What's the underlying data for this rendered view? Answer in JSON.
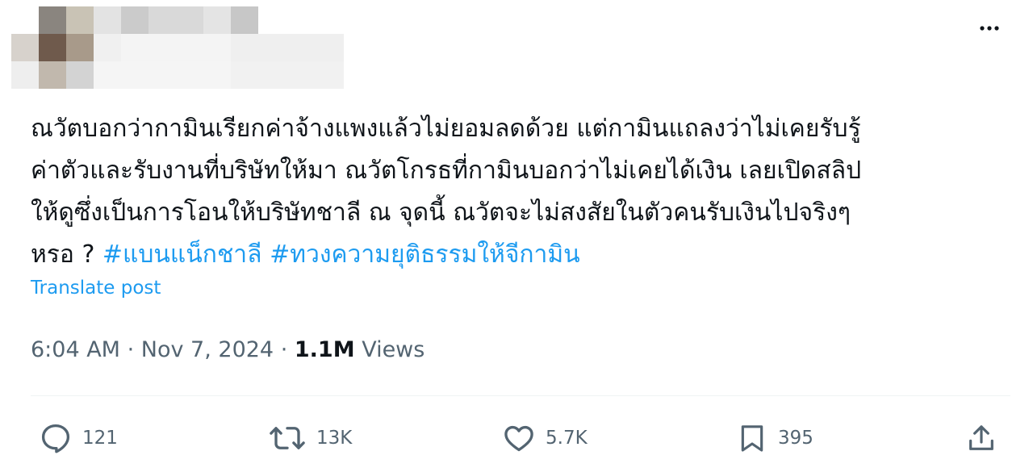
{
  "tweet": {
    "text_lines": [
      "ณวัตบอกว่ากามินเรียกค่าจ้างแพงแล้วไม่ยอมลดด้วย แต่กามินแถลงว่าไม่เคยรับรู้",
      "ค่าตัวและรับงานที่บริษัทให้มา ณวัตโกรธที่กามินบอกว่าไม่เคยได้เงิน เลยเปิดสลิป",
      "ให้ดูซึ่งเป็นการโอนให้บริษัทชาลี ณ จุดนี้ ณวัตจะไม่สงสัยในตัวคนรับเงินไปจริงๆ"
    ],
    "last_line_text": "หรอ ? ",
    "hashtags": [
      "#แบนแน็กชาลี",
      "#ทวงความยุติธรรมให้จีกามิน"
    ],
    "translate_label": "Translate post",
    "time": "6:04 AM",
    "date": "Nov 7, 2024",
    "separator": "·",
    "views_count": "1.1M",
    "views_label": "Views"
  },
  "actions": {
    "replies": "121",
    "reposts": "13K",
    "likes": "5.7K",
    "bookmarks": "395"
  },
  "colors": {
    "accent": "#1d9bf0",
    "secondary_text": "#536471",
    "primary_text": "#0f1419"
  },
  "icons": [
    "more-icon",
    "reply-icon",
    "repost-icon",
    "like-icon",
    "bookmark-icon",
    "share-icon"
  ]
}
